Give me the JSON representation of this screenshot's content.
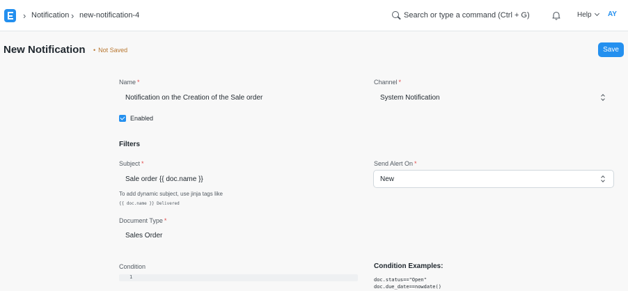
{
  "navbar": {
    "breadcrumbs": [
      "Notification",
      "new-notification-4"
    ],
    "search_placeholder": "Search or type a command (Ctrl + G)",
    "help_label": "Help",
    "avatar_initials": "AY"
  },
  "page": {
    "title": "New Notification",
    "status": "Not Saved",
    "save_label": "Save"
  },
  "form": {
    "name": {
      "label": "Name",
      "value": "Notification on the Creation of the Sale order"
    },
    "channel": {
      "label": "Channel",
      "value": "System Notification"
    },
    "enabled": {
      "label": "Enabled",
      "checked": true
    },
    "filters_title": "Filters",
    "subject": {
      "label": "Subject",
      "value": "Sale order {{ doc.name }}",
      "help": "To add dynamic subject, use jinja tags like",
      "help_code": "{{ doc.name }} Delivered"
    },
    "send_alert_on": {
      "label": "Send Alert On",
      "value": "New"
    },
    "document_type": {
      "label": "Document Type",
      "value": "Sales Order"
    },
    "condition": {
      "label": "Condition",
      "line_number": "1"
    },
    "condition_examples": {
      "title": "Condition Examples:",
      "lines": [
        "doc.status==\"Open\"",
        "doc.due_date==nowdate()"
      ]
    }
  },
  "colors": {
    "primary": "#2490ef",
    "not_saved": "#b8762f",
    "required": "#e24c4c"
  }
}
